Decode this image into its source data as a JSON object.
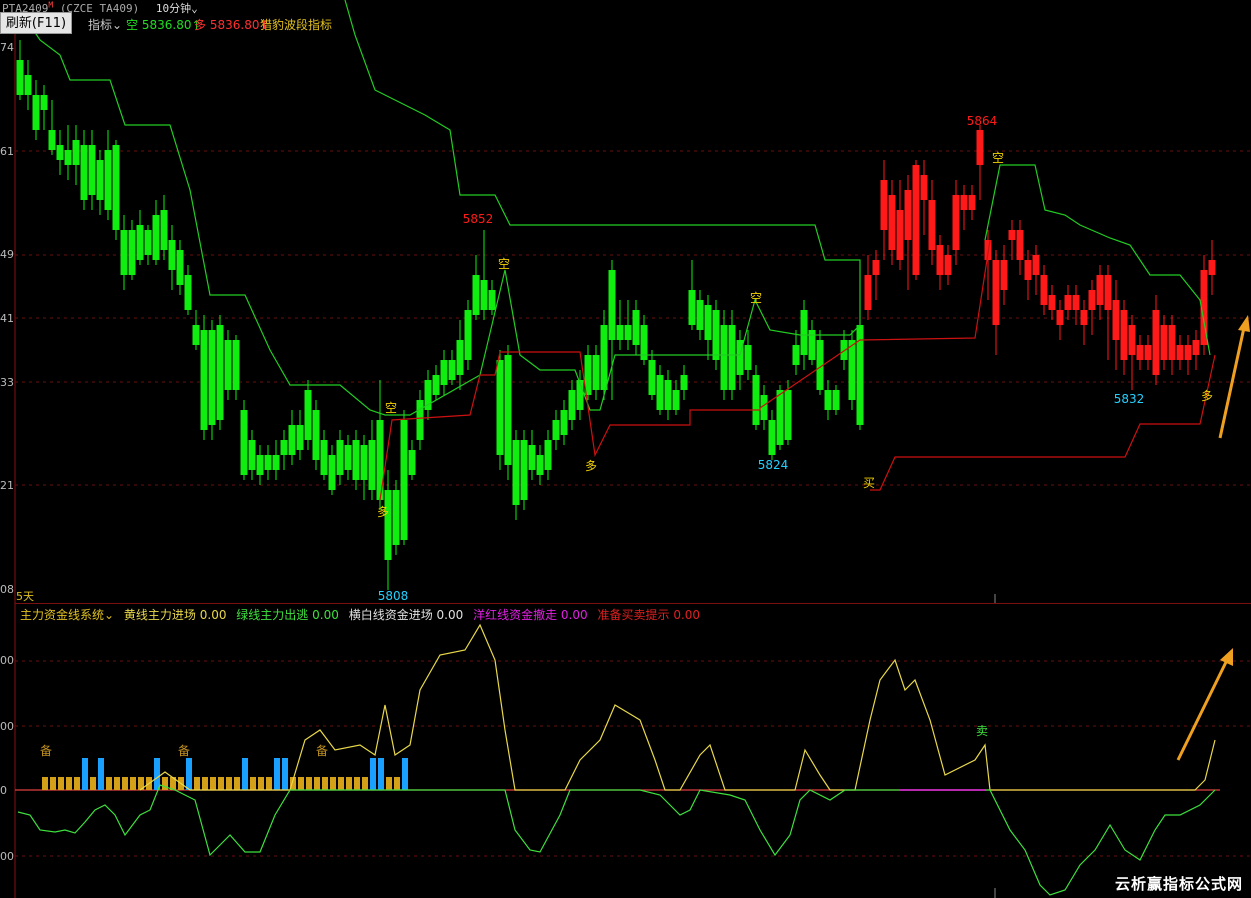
{
  "title_bar": {
    "symbol": "PTA2409",
    "suffix": "M",
    "code": "(CZCE TA409)",
    "period": "10分钟"
  },
  "refresh_button": "刷新(F11)",
  "top_legend": {
    "indicator_name": "指标",
    "short_label": "空",
    "short_value": "5836.80",
    "short_arrow": "↑",
    "long_label": "多",
    "long_value": "5836.80",
    "long_arrow": "↑",
    "system_name": "猎豹波段指标"
  },
  "price_axis": [
    "74",
    "61",
    "49",
    "41",
    "33",
    "21",
    "08"
  ],
  "days_label": "5天",
  "bottom_legend": {
    "system": "主力资金线系统",
    "yellow": "黄线主力进场",
    "yellow_val": "0.00",
    "green": "绿线主力出逃",
    "green_val": "0.00",
    "white": "横白线资金进场",
    "white_val": "0.00",
    "magenta": "洋红线资金撤走",
    "magenta_val": "0.00",
    "red": "准备买卖提示",
    "red_val": "0.00"
  },
  "indicator_axis": [
    "00",
    "00",
    "0",
    "00"
  ],
  "chart_data": {
    "type": "candlestick",
    "price_marks": [
      "5852",
      "5808",
      "5824",
      "5864",
      "5832"
    ],
    "signals": [
      "空",
      "多",
      "空",
      "多",
      "空",
      "多",
      "买",
      "空",
      "多"
    ],
    "indicator_marks": [
      "备",
      "备",
      "备",
      "卖"
    ]
  },
  "colors": {
    "up": "#ff1a1a",
    "down": "#10ee10",
    "stop_line": "#22cc22",
    "support_line": "#cc1111",
    "signal": "#f0d000",
    "yellow_line": "#e8d84a",
    "green_line": "#3ee03e"
  },
  "watermark": "云析赢指标公式网"
}
